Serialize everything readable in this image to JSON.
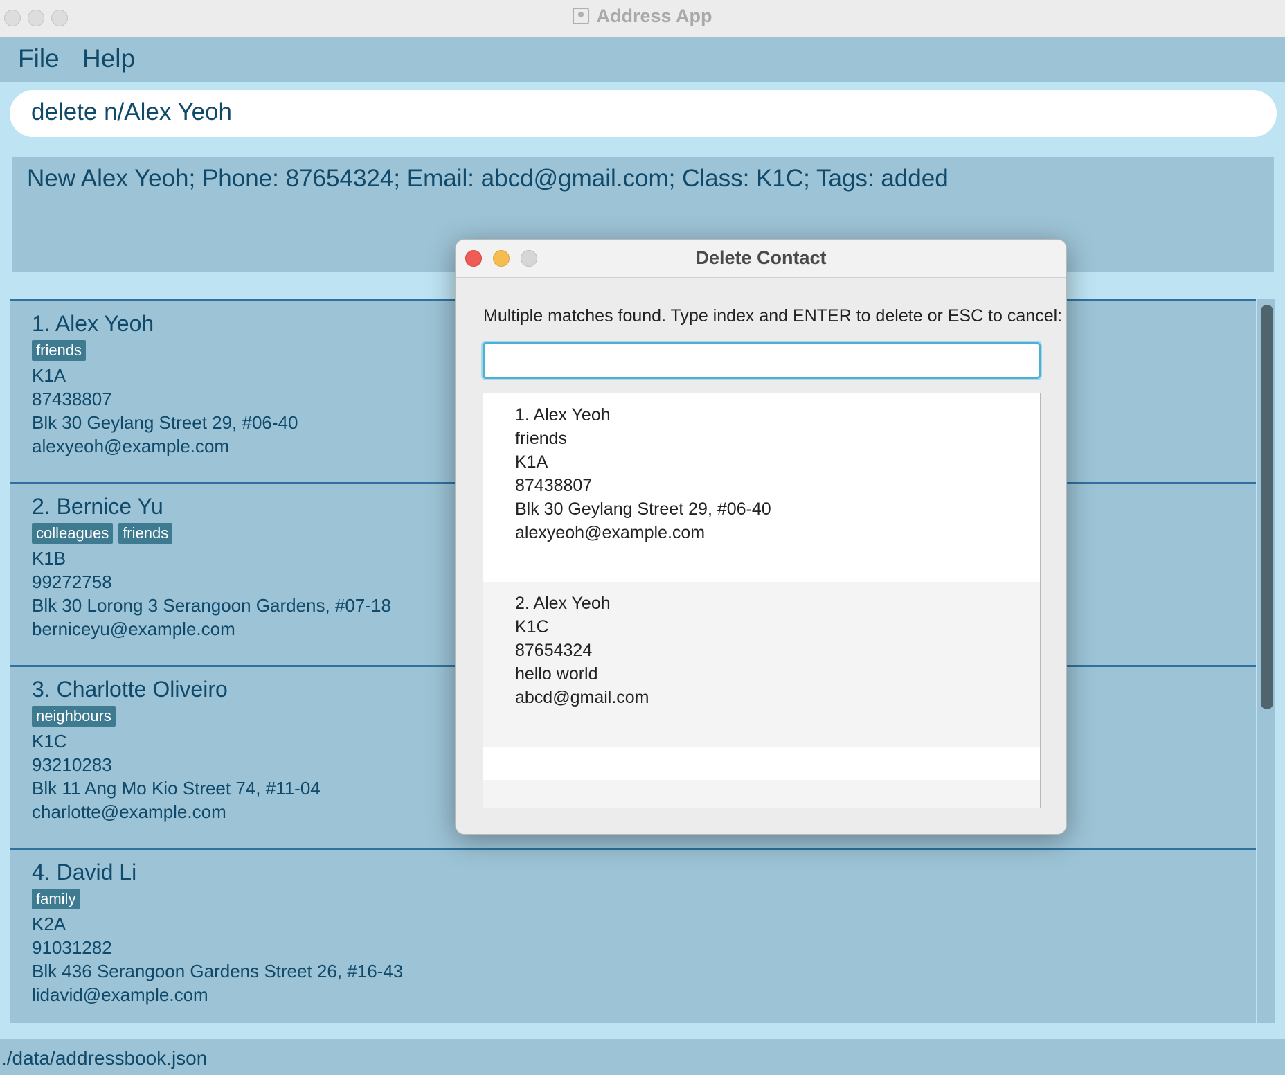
{
  "window": {
    "title": "Address App"
  },
  "menu": {
    "file": "File",
    "help": "Help"
  },
  "command_box": {
    "value": "delete n/Alex Yeoh"
  },
  "result_display": {
    "text": "New Alex Yeoh; Phone: 87654324; Email: abcd@gmail.com; Class: K1C; Tags:  added"
  },
  "persons": [
    {
      "name": "1. Alex Yeoh",
      "tags": [
        "friends"
      ],
      "class": "K1A",
      "phone": "87438807",
      "address": "Blk 30 Geylang Street 29, #06-40",
      "email": "alexyeoh@example.com"
    },
    {
      "name": "2. Bernice Yu",
      "tags": [
        "colleagues",
        "friends"
      ],
      "class": "K1B",
      "phone": "99272758",
      "address": "Blk 30 Lorong 3 Serangoon Gardens, #07-18",
      "email": "berniceyu@example.com"
    },
    {
      "name": "3. Charlotte Oliveiro",
      "tags": [
        "neighbours"
      ],
      "class": "K1C",
      "phone": "93210283",
      "address": "Blk 11 Ang Mo Kio Street 74, #11-04",
      "email": "charlotte@example.com"
    },
    {
      "name": "4. David Li",
      "tags": [
        "family"
      ],
      "class": "K2A",
      "phone": "91031282",
      "address": "Blk 436 Serangoon Gardens Street 26, #16-43",
      "email": "lidavid@example.com"
    }
  ],
  "status_bar": {
    "path": "./data/addressbook.json"
  },
  "dialog": {
    "title": "Delete Contact",
    "prompt": "Multiple matches found. Type index and ENTER to delete or ESC to cancel:",
    "input_value": "",
    "matches": [
      {
        "name": "1. Alex Yeoh",
        "lines": [
          "friends",
          "K1A",
          "87438807",
          "Blk 30 Geylang Street 29, #06-40",
          "alexyeoh@example.com"
        ]
      },
      {
        "name": "2. Alex Yeoh",
        "lines": [
          "K1C",
          "87654324",
          "hello world",
          "abcd@gmail.com"
        ]
      }
    ]
  },
  "colors": {
    "background": "#bee3f3",
    "panel": "#9cc3d6",
    "text": "#10496a",
    "tag": "#3e7b91",
    "focus_ring": "#4ab0d4",
    "close_red": "#ee5c55",
    "minimize_yellow": "#f5bd4f"
  },
  "icons": [
    "address-app-icon",
    "close-icon",
    "minimize-icon",
    "zoom-icon"
  ]
}
